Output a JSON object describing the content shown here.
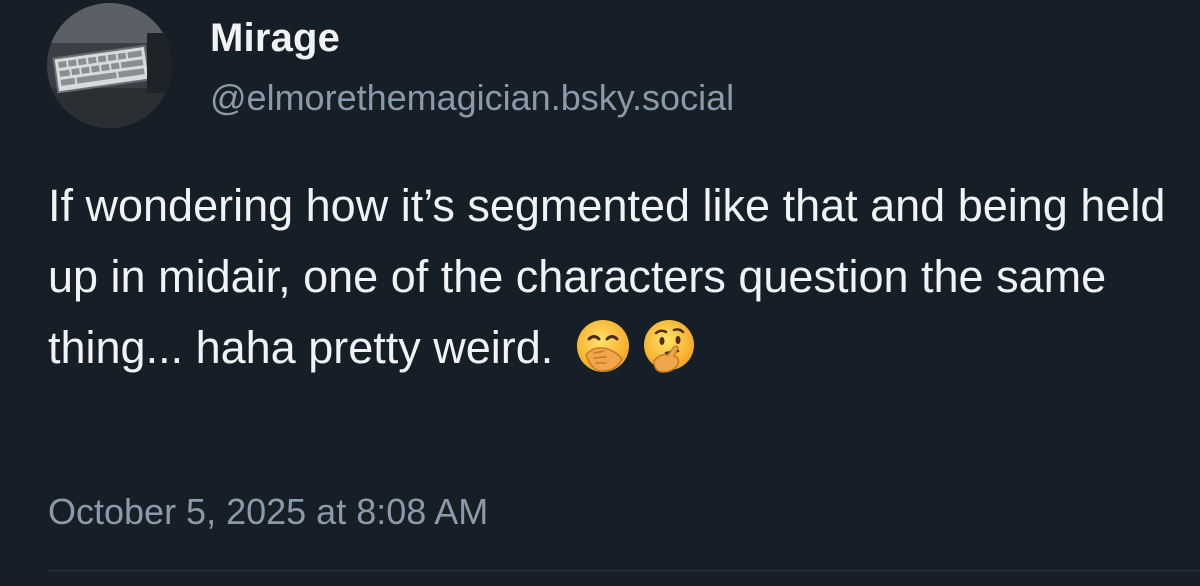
{
  "post": {
    "author": {
      "display_name": "Mirage",
      "handle": "@elmorethemagician.bsky.social"
    },
    "text": "If wondering how it’s segmented like that and being held up in midair, one of the characters question the same thing... haha pretty weird.",
    "emojis": [
      "face-with-hand-over-mouth",
      "thinking-face"
    ],
    "timestamp": "October 5, 2025 at 8:08 AM"
  },
  "colors": {
    "background": "#161e27",
    "text_primary": "#f1f3f5",
    "text_secondary": "#8c99a8",
    "divider": "#2b3542"
  }
}
